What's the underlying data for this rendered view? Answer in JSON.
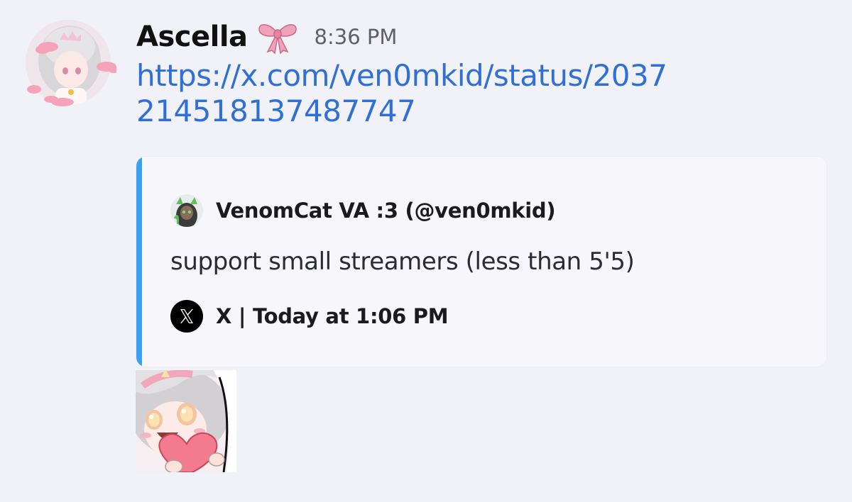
{
  "message": {
    "username": "Ascella",
    "badge_icon": "ribbon-bow-icon",
    "timestamp": "8:36 PM",
    "link_text": "https://x.com/ven0mkid/status/2037214518137487747",
    "avatar_icon": "anime-girl-avatar"
  },
  "embed": {
    "accent_color": "#3ca0f0",
    "author": "VenomCat VA :3 (@ven0mkid)",
    "author_icon": "venomcat-avatar",
    "description": "support small streamers (less than 5'5)",
    "footer": "X | Today at 1:06 PM",
    "footer_icon": "x-logo-icon"
  },
  "sticker": {
    "icon": "anime-girl-heart-sticker"
  },
  "colors": {
    "background": "#f1f1f8",
    "link": "#2f6fd6",
    "timestamp": "#5e5f68"
  }
}
